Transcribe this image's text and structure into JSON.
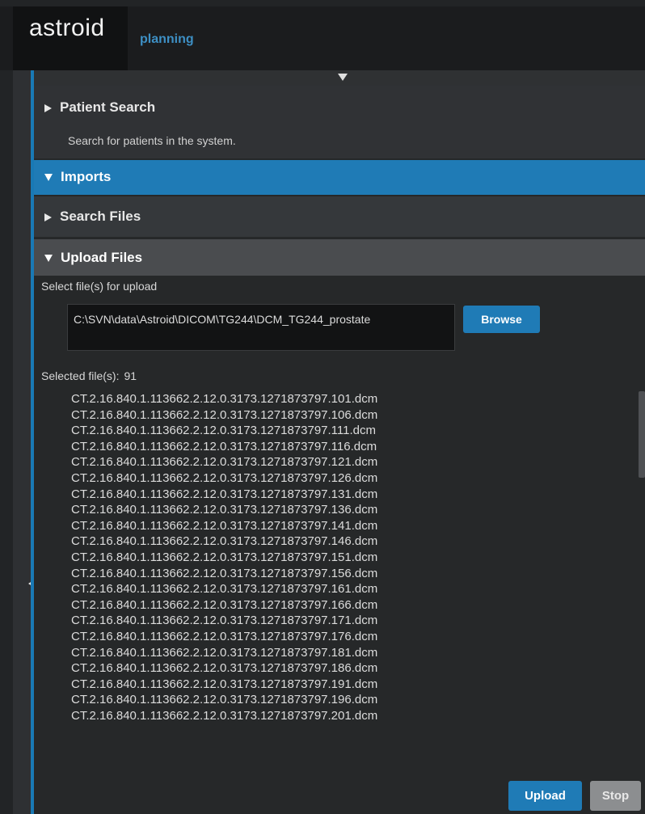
{
  "header": {
    "logo": "astroid",
    "module": "planning"
  },
  "patient_search": {
    "title": "Patient Search",
    "description": "Search for patients in the system."
  },
  "imports": {
    "title": "Imports",
    "search_files": {
      "title": "Search Files"
    },
    "upload_files": {
      "title": "Upload Files",
      "select_label": "Select file(s) for upload",
      "path": "C:\\SVN\\data\\Astroid\\DICOM\\TG244\\DCM_TG244_prostate",
      "browse_label": "Browse",
      "selected_label": "Selected file(s):",
      "selected_count": "91",
      "files": [
        "CT.2.16.840.1.113662.2.12.0.3173.1271873797.101.dcm",
        "CT.2.16.840.1.113662.2.12.0.3173.1271873797.106.dcm",
        "CT.2.16.840.1.113662.2.12.0.3173.1271873797.111.dcm",
        "CT.2.16.840.1.113662.2.12.0.3173.1271873797.116.dcm",
        "CT.2.16.840.1.113662.2.12.0.3173.1271873797.121.dcm",
        "CT.2.16.840.1.113662.2.12.0.3173.1271873797.126.dcm",
        "CT.2.16.840.1.113662.2.12.0.3173.1271873797.131.dcm",
        "CT.2.16.840.1.113662.2.12.0.3173.1271873797.136.dcm",
        "CT.2.16.840.1.113662.2.12.0.3173.1271873797.141.dcm",
        "CT.2.16.840.1.113662.2.12.0.3173.1271873797.146.dcm",
        "CT.2.16.840.1.113662.2.12.0.3173.1271873797.151.dcm",
        "CT.2.16.840.1.113662.2.12.0.3173.1271873797.156.dcm",
        "CT.2.16.840.1.113662.2.12.0.3173.1271873797.161.dcm",
        "CT.2.16.840.1.113662.2.12.0.3173.1271873797.166.dcm",
        "CT.2.16.840.1.113662.2.12.0.3173.1271873797.171.dcm",
        "CT.2.16.840.1.113662.2.12.0.3173.1271873797.176.dcm",
        "CT.2.16.840.1.113662.2.12.0.3173.1271873797.181.dcm",
        "CT.2.16.840.1.113662.2.12.0.3173.1271873797.186.dcm",
        "CT.2.16.840.1.113662.2.12.0.3173.1271873797.191.dcm",
        "CT.2.16.840.1.113662.2.12.0.3173.1271873797.196.dcm",
        "CT.2.16.840.1.113662.2.12.0.3173.1271873797.201.dcm"
      ],
      "upload_label": "Upload",
      "stop_label": "Stop"
    }
  },
  "colors": {
    "accent": "#1f7bb6",
    "background": "#262829",
    "module_text": "#3d8fc4"
  },
  "icons": {
    "expand_top": "triangle-down-icon",
    "collapsed_section": "triangle-right-icon",
    "expanded_section": "triangle-down-icon",
    "left_rail": "triangle-left-icon"
  }
}
